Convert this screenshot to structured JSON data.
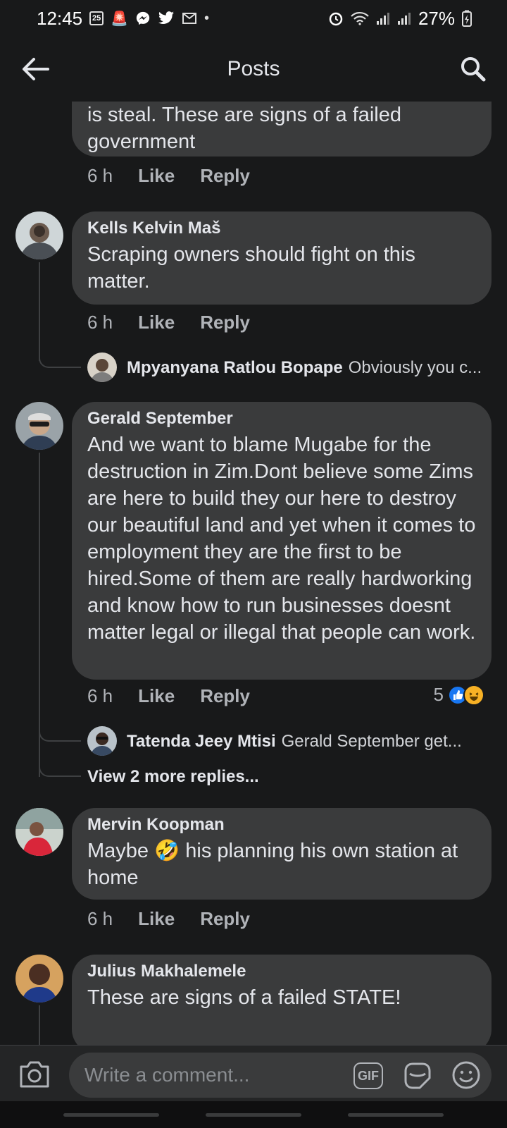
{
  "status": {
    "time": "12:45",
    "calendar_day": "25",
    "battery": "27%"
  },
  "header": {
    "title": "Posts"
  },
  "comments": [
    {
      "author": "",
      "text": "is steal. These are signs of a failed government",
      "time": "6 h",
      "like": "Like",
      "reply": "Reply"
    },
    {
      "author": "Kells Kelvin Maš",
      "text": "Scraping owners should fight on this matter.",
      "time": "6 h",
      "like": "Like",
      "reply": "Reply",
      "reply_preview": {
        "author": "Mpyanyana Ratlou Bopape",
        "snippet": "Obviously you c..."
      }
    },
    {
      "author": "Gerald September",
      "text": "And we want to blame Mugabe for the destruction in Zim.Dont believe some Zims are here to build they our here to destroy our beautiful land and yet when it comes to employment they are the first to be hired.Some of them are really hardworking and know how to run businesses doesnt matter legal or illegal that people can work.",
      "time": "6 h",
      "like": "Like",
      "reply": "Reply",
      "reaction_count": "5",
      "reply_preview": {
        "author": "Tatenda Jeey Mtisi",
        "snippet": "Gerald September  get..."
      },
      "view_more": "View 2 more replies..."
    },
    {
      "author": "Mervin Koopman",
      "text_before": "Maybe",
      "emoji": "🤣",
      "text_after": "his planning his own station at home",
      "time": "6 h",
      "like": "Like",
      "reply": "Reply"
    },
    {
      "author": "Julius Makhalemele",
      "text": "These are signs of a failed STATE!"
    }
  ],
  "composer": {
    "placeholder": "Write a comment...",
    "gif_label": "GIF"
  },
  "colors": {
    "background": "#18191a",
    "bubble": "#3a3b3c",
    "like_blue": "#1877f2",
    "haha_yellow": "#f7b125"
  }
}
